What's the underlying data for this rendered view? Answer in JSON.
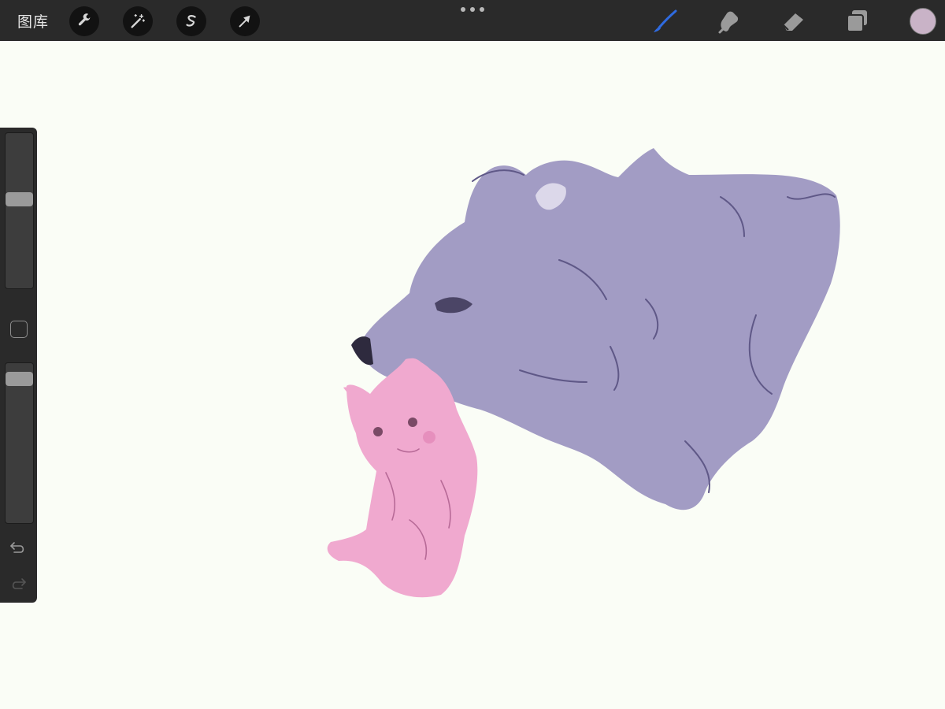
{
  "toolbar": {
    "gallery_label": "图库",
    "left_tools": [
      "wrench-icon",
      "magic-wand-icon",
      "selection-icon",
      "transform-arrow-icon"
    ],
    "right_tools": [
      "brush-icon",
      "smudge-icon",
      "eraser-icon",
      "layers-icon"
    ],
    "active_tool": "brush-icon",
    "current_color": "#c9b3c7",
    "active_color": "#2f6be0"
  },
  "sidebar": {
    "brush_size_level": 0.58,
    "opacity_level": 0.94,
    "undo_icon": "undo-icon",
    "redo_icon": "redo-icon"
  },
  "canvas": {
    "background": "#fafdf6",
    "artwork": [
      "purple-bear-head",
      "pink-kitten"
    ],
    "bear_color": "#a29cc4",
    "kitten_color": "#f0a9cf"
  }
}
